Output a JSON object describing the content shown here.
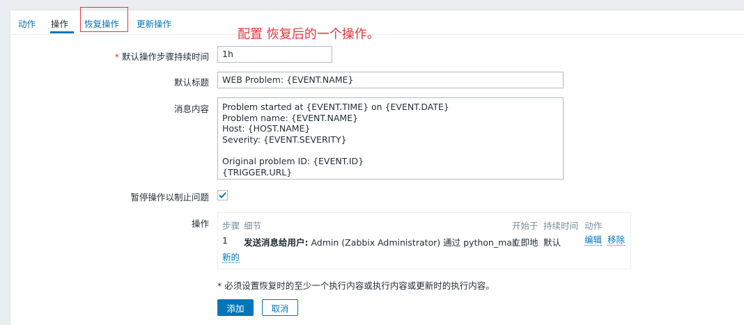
{
  "tabs": [
    {
      "label": "动作"
    },
    {
      "label": "操作"
    },
    {
      "label": "恢复操作"
    },
    {
      "label": "更新操作"
    }
  ],
  "annotation": "配置  恢复后的一个操作。",
  "form": {
    "duration_label": "默认操作步骤持续时间",
    "duration_required_mark": "*",
    "duration_value": "1h",
    "subject_label": "默认标题",
    "subject_value": "WEB Problem: {EVENT.NAME}",
    "message_label": "消息内容",
    "message_value": "Problem started at {EVENT.TIME} on {EVENT.DATE}\nProblem name: {EVENT.NAME}\nHost: {HOST.NAME}\nSeverity: {EVENT.SEVERITY}\n\nOriginal problem ID: {EVENT.ID}\n{TRIGGER.URL}",
    "pause_label": "暂停操作以制止问题",
    "pause_checked": true,
    "operations_label": "操作"
  },
  "operations": {
    "headers": {
      "step": "步骤",
      "details": "细节",
      "start_in": "开始于",
      "duration": "持续时间",
      "action": "动作"
    },
    "rows": [
      {
        "step": "1",
        "details_bold": "发送消息给用户:",
        "details_rest": " Admin (Zabbix Administrator) 通过 python_mail",
        "start_in": "立即地",
        "duration": "默认",
        "edit": "编辑",
        "remove": "移除"
      }
    ],
    "new_link": "新的"
  },
  "note": "* 必须设置恢复时的至少一个执行内容或执行内容或更新时的执行内容。",
  "buttons": {
    "add": "添加",
    "cancel": "取消"
  },
  "colors": {
    "accent": "#0275b8",
    "required": "#e3373c"
  }
}
